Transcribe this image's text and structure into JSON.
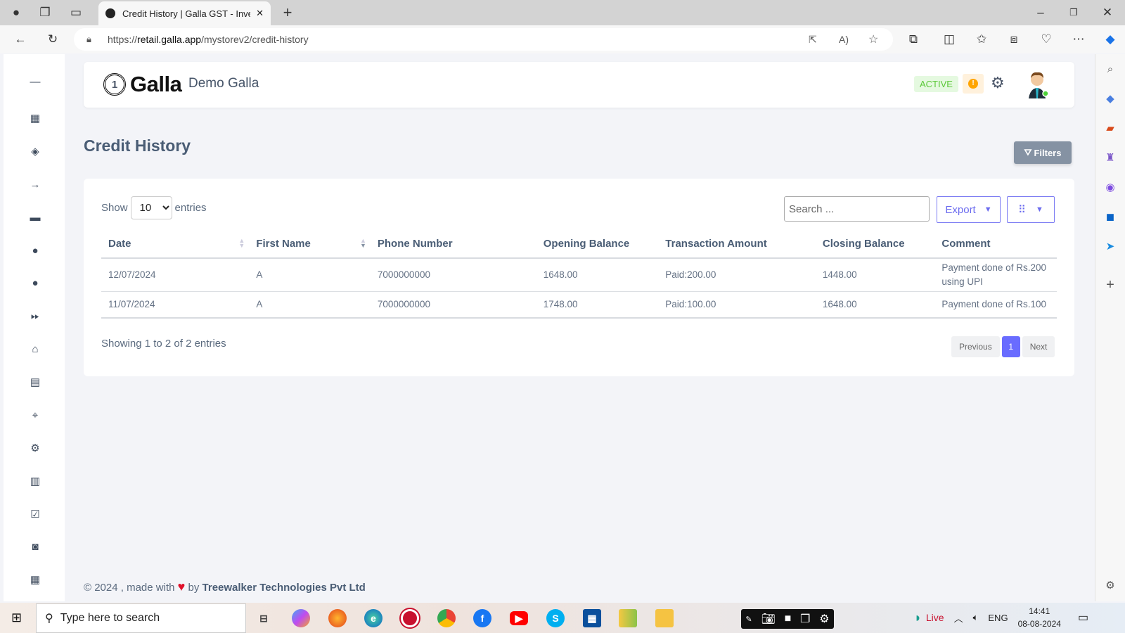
{
  "browser": {
    "tab_title": "Credit History | Galla GST - Inven",
    "url_prefix": "https://",
    "url_host": "retail.galla.app",
    "url_path": "/mystorev2/credit-history"
  },
  "header": {
    "brand": "Galla",
    "store_name": "Demo Galla",
    "status_badge": "ACTIVE",
    "status_color": "#5cc93a",
    "warning_color": "#ffa500"
  },
  "page": {
    "title": "Credit History",
    "filters_label": "Filters"
  },
  "table_controls": {
    "show_label": "Show",
    "entries_label": "entries",
    "page_size": "10",
    "search_placeholder": "Search ...",
    "export_label": "Export"
  },
  "table": {
    "columns": [
      "Date",
      "First Name",
      "Phone Number",
      "Opening Balance",
      "Transaction Amount",
      "Closing Balance",
      "Comment"
    ],
    "rows": [
      [
        "12/07/2024",
        "A",
        "7000000000",
        "1648.00",
        "Paid:200.00",
        "1448.00",
        "Payment done of Rs.200 using UPI"
      ],
      [
        "11/07/2024",
        "A",
        "7000000000",
        "1748.00",
        "Paid:100.00",
        "1648.00",
        "Payment done of Rs.100"
      ]
    ]
  },
  "pagination": {
    "info": "Showing 1 to 2 of 2 entries",
    "previous": "Previous",
    "current": "1",
    "next": "Next",
    "accent": "#696cff"
  },
  "footer": {
    "prefix": "© 2024 , made with",
    "by": "by",
    "company": "Treewalker Technologies Pvt Ltd"
  },
  "taskbar": {
    "search_placeholder": "Type here to search",
    "live_label": "Live",
    "language": "ENG",
    "time": "14:41",
    "date": "08-08-2024"
  }
}
